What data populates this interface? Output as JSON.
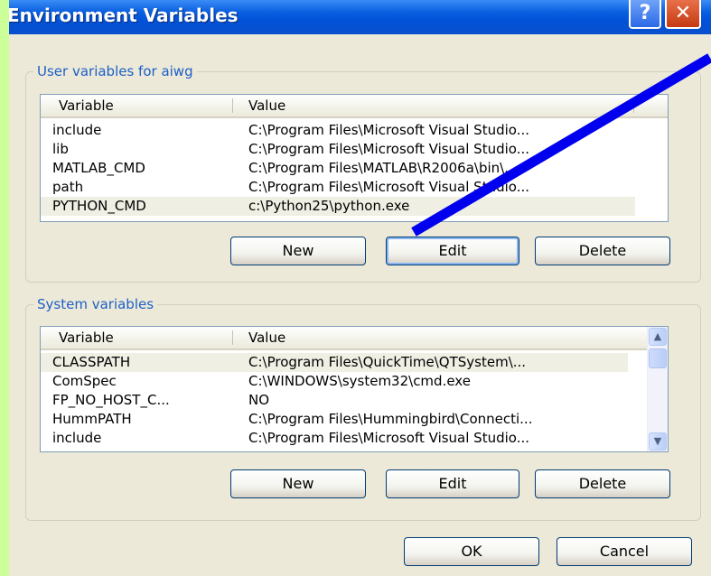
{
  "window": {
    "title": "Environment Variables",
    "help_glyph": "?",
    "close_glyph": "✕"
  },
  "user_vars": {
    "group_label": "User variables for aiwg",
    "columns": [
      "Variable",
      "Value"
    ],
    "rows": [
      {
        "variable": "include",
        "value": "C:\\Program Files\\Microsoft Visual Studio..."
      },
      {
        "variable": "lib",
        "value": "C:\\Program Files\\Microsoft Visual Studio..."
      },
      {
        "variable": "MATLAB_CMD",
        "value": "C:\\Program Files\\MATLAB\\R2006a\\bin\\..."
      },
      {
        "variable": "path",
        "value": "C:\\Program Files\\Microsoft Visual Studio..."
      },
      {
        "variable": "PYTHON_CMD",
        "value": "c:\\Python25\\python.exe"
      }
    ],
    "selected_index": 4,
    "buttons": {
      "new": "New",
      "edit": "Edit",
      "delete": "Delete"
    }
  },
  "system_vars": {
    "group_label": "System variables",
    "columns": [
      "Variable",
      "Value"
    ],
    "rows": [
      {
        "variable": "CLASSPATH",
        "value": "C:\\Program Files\\QuickTime\\QTSystem\\..."
      },
      {
        "variable": "ComSpec",
        "value": "C:\\WINDOWS\\system32\\cmd.exe"
      },
      {
        "variable": "FP_NO_HOST_C...",
        "value": "NO"
      },
      {
        "variable": "HummPATH",
        "value": "C:\\Program Files\\Hummingbird\\Connecti..."
      },
      {
        "variable": "include",
        "value": "C:\\Program Files\\Microsoft Visual Studio..."
      }
    ],
    "selected_index": 0,
    "scroll_up_glyph": "▲",
    "scroll_down_glyph": "▼",
    "buttons": {
      "new": "New",
      "edit": "Edit",
      "delete": "Delete"
    }
  },
  "footer": {
    "ok": "OK",
    "cancel": "Cancel"
  },
  "annotation": {
    "arrow_color": "#0000ee"
  }
}
